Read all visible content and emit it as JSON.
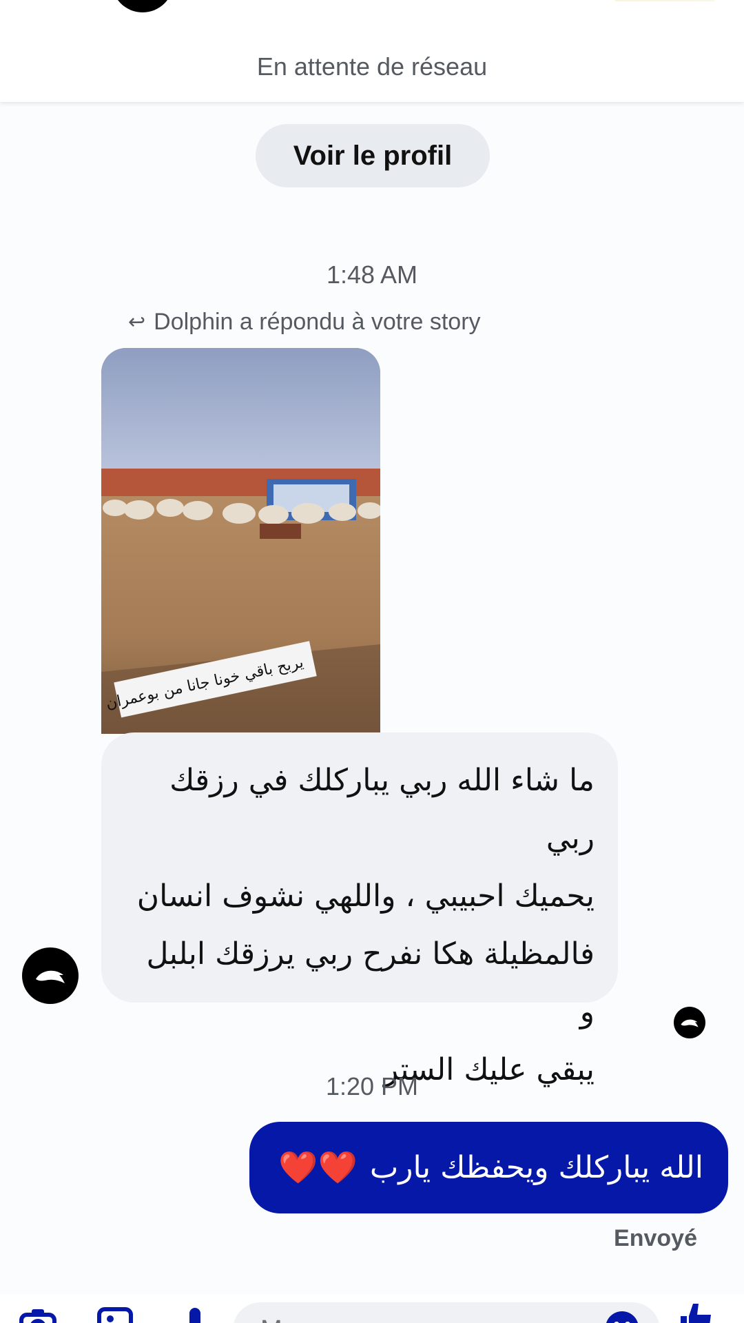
{
  "header": {
    "status": "En attente de réseau"
  },
  "profile_button": {
    "label": "Voir le profil"
  },
  "conversation": {
    "timestamp_1": "1:48 AM",
    "story_reply_note": "Dolphin a répondu à votre story",
    "story_caption": "يربح باقي خونا جانا من بوعمران",
    "received_message_lines": [
      "ما شاء الله ربي يباركلك في رزقك ربي",
      "يحميك احبيبي ، واللهي نشوف انسان",
      "فالمظيلة هكا نفرح ربي يرزقك ابلبل  و",
      "يبقي عليك الستر"
    ],
    "timestamp_2": "1:20 PM",
    "sent_message": "الله يباركلك ويحفظك يارب",
    "sent_hearts": "❤️❤️",
    "sent_status": "Envoyé"
  },
  "composer": {
    "placeholder": "Message"
  },
  "icons": {
    "reply": "reply-arrow-icon",
    "avatar": "dolphin-icon",
    "camera": "camera-icon",
    "gallery": "image-icon",
    "mic": "microphone-icon",
    "emoji": "emoji-icon",
    "like": "thumbs-up-icon"
  },
  "colors": {
    "sent_bubble": "#0518a8",
    "received_bubble": "#eff1f5",
    "accent": "#0518a8"
  }
}
